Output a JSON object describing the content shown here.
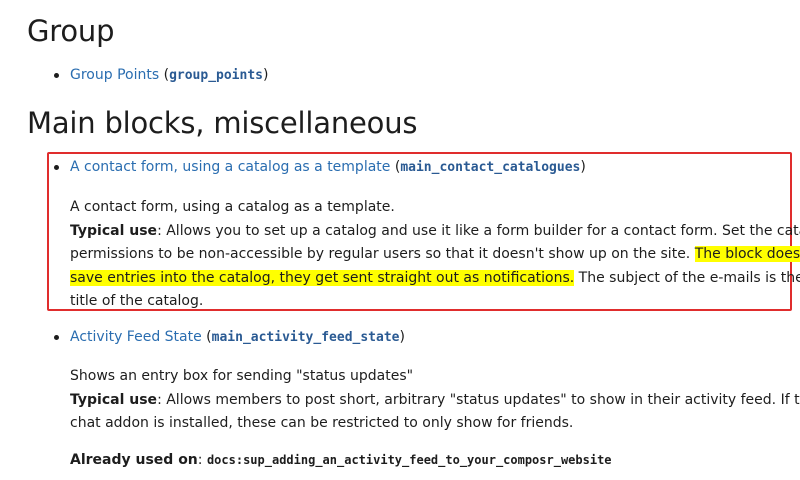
{
  "section_group": {
    "heading": "Group",
    "link_text": "Group Points",
    "code": "group_points"
  },
  "section_main": {
    "heading": "Main blocks, miscellaneous",
    "items": [
      {
        "link_text": "A contact form, using a catalog as a template",
        "code": "main_contact_catalogues",
        "description": "A contact form, using a catalog as a template.",
        "typical_use_label": "Typical use",
        "typical_use_line1": ": Allows you to set up a catalog and use it like a form builder for a contact form. Set the catalog",
        "typical_use_line2a": "permissions to be non-accessible by regular users so that it doesn't show up on the site. ",
        "highlight_line2": "The block doesn't",
        "highlight_line3": "save entries into the catalog, they get sent straight out as notifications.",
        "typical_use_line3b": " The subject of the e-mails is the",
        "typical_use_line4": "title of the catalog."
      },
      {
        "link_text": "Activity Feed State",
        "code": "main_activity_feed_state",
        "description": "Shows an entry box for sending \"status updates\"",
        "typical_use_label": "Typical use",
        "typical_use_line1": ": Allows members to post short, arbitrary \"status updates\" to show in their activity feed. If the",
        "typical_use_line2": "chat addon is installed, these can be restricted to only show for friends.",
        "already_used_label": "Already used on",
        "already_used_value": "docs:sup_adding_an_activity_feed_to_your_composr_website"
      }
    ]
  },
  "colors": {
    "link": "#2a6db0",
    "code": "#2a5a93",
    "highlight": "#ffff00",
    "annotation_box": "#e02d2d"
  }
}
